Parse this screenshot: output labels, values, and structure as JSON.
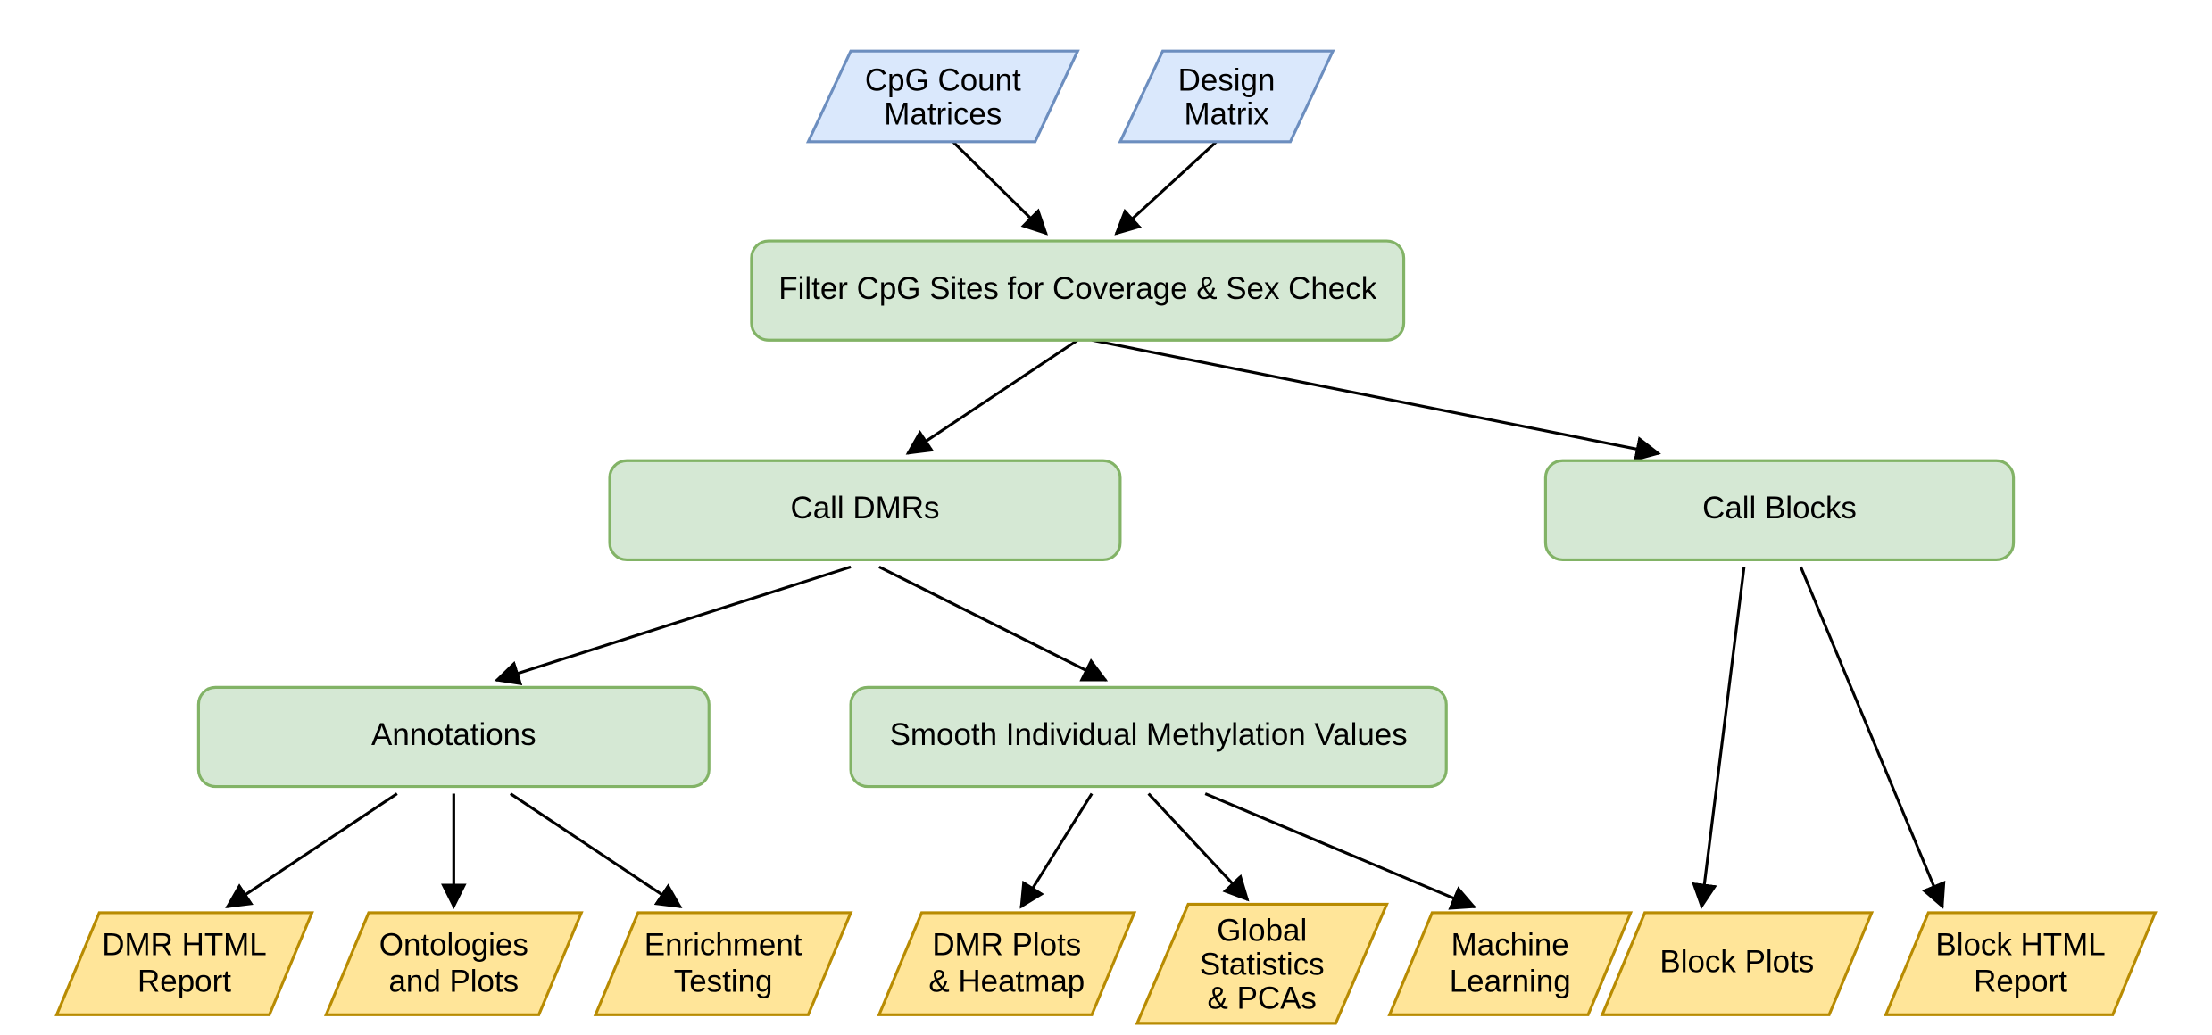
{
  "colors": {
    "input_fill": "#dae8fc",
    "input_stroke": "#6c8ebf",
    "process_fill": "#d5e8d4",
    "process_stroke": "#82b366",
    "output_fill": "#ffe599",
    "output_stroke": "#b88b02"
  },
  "nodes": {
    "cpg_count": {
      "type": "input",
      "lines": [
        "CpG Count",
        "Matrices"
      ]
    },
    "design": {
      "type": "input",
      "lines": [
        "Design",
        "Matrix"
      ]
    },
    "filter": {
      "type": "process",
      "lines": [
        "Filter CpG Sites for Coverage & Sex Check"
      ]
    },
    "call_dmrs": {
      "type": "process",
      "lines": [
        "Call DMRs"
      ]
    },
    "call_blocks": {
      "type": "process",
      "lines": [
        "Call Blocks"
      ]
    },
    "annotations": {
      "type": "process",
      "lines": [
        "Annotations"
      ]
    },
    "smooth": {
      "type": "process",
      "lines": [
        "Smooth Individual Methylation Values"
      ]
    },
    "dmr_report": {
      "type": "output",
      "lines": [
        "DMR HTML",
        "Report"
      ]
    },
    "ontologies": {
      "type": "output",
      "lines": [
        "Ontologies",
        "and Plots"
      ]
    },
    "enrichment": {
      "type": "output",
      "lines": [
        "Enrichment",
        "Testing"
      ]
    },
    "dmr_plots": {
      "type": "output",
      "lines": [
        "DMR Plots",
        "& Heatmap"
      ]
    },
    "global_stats": {
      "type": "output",
      "lines": [
        "Global",
        "Statistics",
        "& PCAs"
      ]
    },
    "ml": {
      "type": "output",
      "lines": [
        "Machine",
        "Learning"
      ]
    },
    "block_plots": {
      "type": "output",
      "lines": [
        "Block Plots"
      ]
    },
    "block_report": {
      "type": "output",
      "lines": [
        "Block HTML",
        "Report"
      ]
    }
  },
  "edges": [
    [
      "cpg_count",
      "filter"
    ],
    [
      "design",
      "filter"
    ],
    [
      "filter",
      "call_dmrs"
    ],
    [
      "filter",
      "call_blocks"
    ],
    [
      "call_dmrs",
      "annotations"
    ],
    [
      "call_dmrs",
      "smooth"
    ],
    [
      "annotations",
      "dmr_report"
    ],
    [
      "annotations",
      "ontologies"
    ],
    [
      "annotations",
      "enrichment"
    ],
    [
      "smooth",
      "dmr_plots"
    ],
    [
      "smooth",
      "global_stats"
    ],
    [
      "smooth",
      "ml"
    ],
    [
      "call_blocks",
      "block_plots"
    ],
    [
      "call_blocks",
      "block_report"
    ]
  ]
}
